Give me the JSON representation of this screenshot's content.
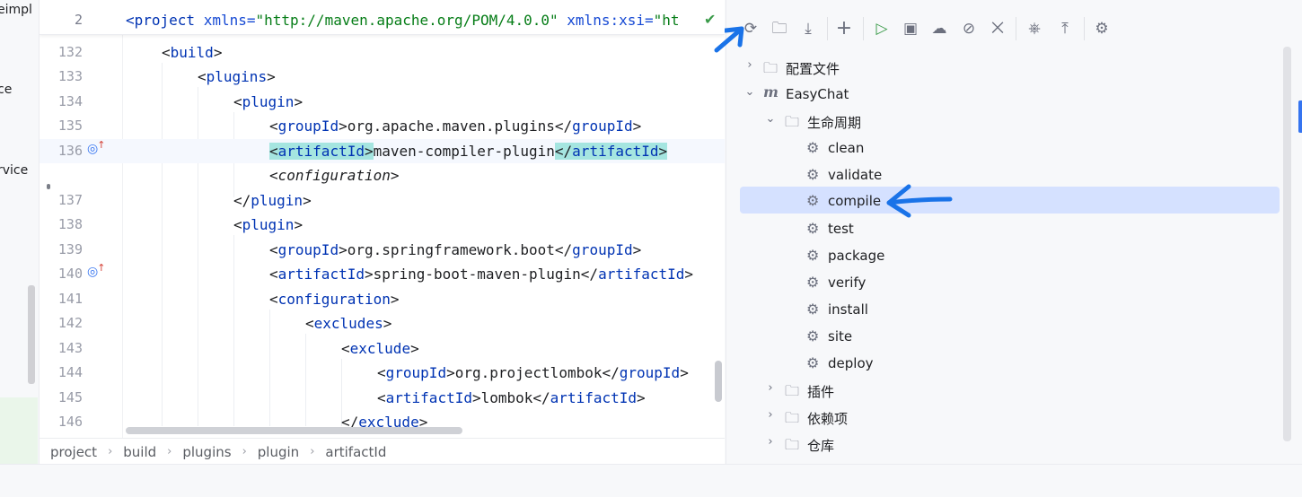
{
  "left_strip": {
    "fragments": [
      "eimpl",
      "ce",
      "rvice"
    ]
  },
  "sticky": {
    "line_number": "2",
    "code_tag": "<project",
    "attr1": " xmlns=",
    "val1": "\"http://maven.apache.org/POM/4.0.0\"",
    "attr2": " xmlns:xsi=",
    "val2": "\"ht"
  },
  "editor": {
    "lines": [
      {
        "n": "132",
        "open": "<",
        "tag": "build",
        "close": ">"
      },
      {
        "n": "133",
        "open": "<",
        "tag": "plugins",
        "close": ">"
      },
      {
        "n": "134",
        "open": "<",
        "tag": "plugin",
        "close": ">"
      },
      {
        "n": "135",
        "t1": "groupId",
        "text": "org.apache.maven.plugins",
        "t2": "groupId"
      },
      {
        "n": "136",
        "t1": "artifactId",
        "text": "maven-compiler-plugin",
        "t2": "artifactId"
      },
      {
        "n": "",
        "comment": "<configuration>"
      },
      {
        "n": "137",
        "open": "</",
        "tag": "plugin",
        "close": ">"
      },
      {
        "n": "138",
        "open": "<",
        "tag": "plugin",
        "close": ">"
      },
      {
        "n": "139",
        "t1": "groupId",
        "text": "org.springframework.boot",
        "t2": "groupId"
      },
      {
        "n": "140",
        "t1": "artifactId",
        "text": "spring-boot-maven-plugin",
        "t2": "artifactId"
      },
      {
        "n": "141",
        "open": "<",
        "tag": "configuration",
        "close": ">"
      },
      {
        "n": "142",
        "open": "<",
        "tag": "excludes",
        "close": ">"
      },
      {
        "n": "143",
        "open": "<",
        "tag": "exclude",
        "close": ">"
      },
      {
        "n": "144",
        "t1": "groupId",
        "text": "org.projectlombok",
        "t2": "groupId"
      },
      {
        "n": "145",
        "t1": "artifactId",
        "text": "lombok",
        "t2": "artifactId"
      },
      {
        "n": "146",
        "open": "</",
        "tag": "exclude",
        "close": ">"
      }
    ]
  },
  "breadcrumb": [
    "project",
    "build",
    "plugins",
    "plugin",
    "artifactId"
  ],
  "maven": {
    "toolbar_icons": [
      "refresh-icon",
      "reimport-folder-icon",
      "download-icon",
      "add-icon",
      "run-icon",
      "run-config-icon",
      "offline-icon",
      "skip-tests-icon",
      "collapse-icon",
      "analyze-icon",
      "expand-icon",
      "settings-icon"
    ],
    "tree": {
      "profiles": "配置文件",
      "project": "EasyChat",
      "lifecycle": "生命周期",
      "phases": [
        "clean",
        "validate",
        "compile",
        "test",
        "package",
        "verify",
        "install",
        "site",
        "deploy"
      ],
      "selected_phase": "compile",
      "plugins": "插件",
      "dependencies": "依赖项",
      "repositories": "仓库"
    }
  },
  "colors": {
    "accent": "#3574f0",
    "selection": "#d5e1ff",
    "tag": "#0033b3",
    "annotation": "#1a73e8"
  }
}
